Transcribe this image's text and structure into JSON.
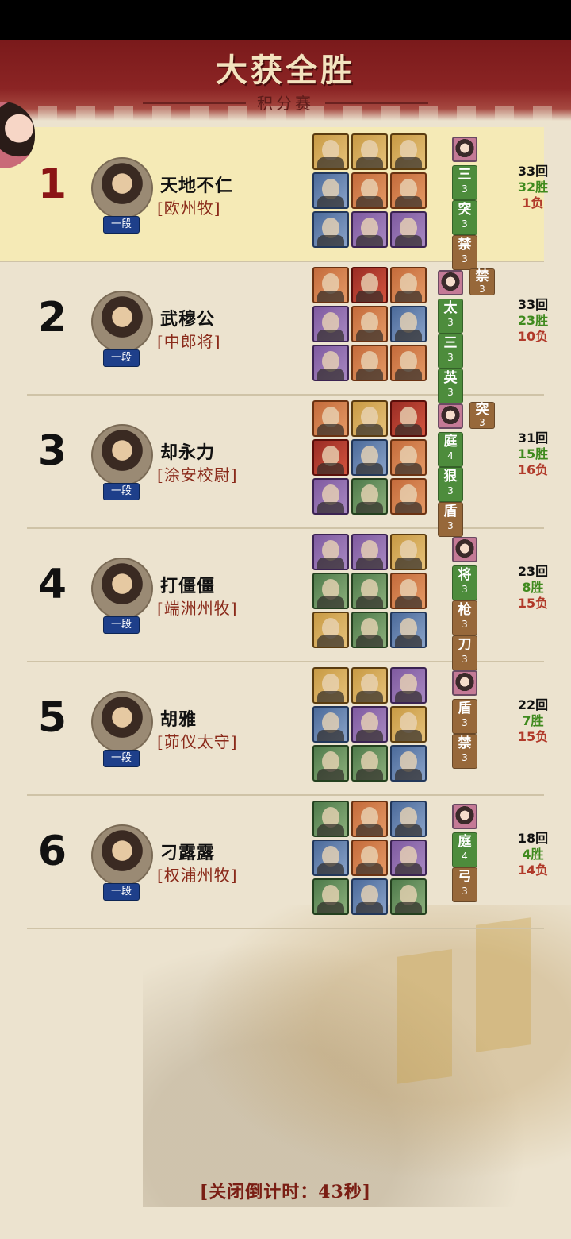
{
  "header": {
    "title": "大获全胜",
    "subtitle": "积分赛"
  },
  "players": [
    {
      "rank": "1",
      "name": "天地不仁",
      "title": "[欧州牧]",
      "badge": "一段",
      "rounds": "33回",
      "wins": "32胜",
      "losses": "1负",
      "highlight": true,
      "cards": [
        "gold",
        "gold",
        "gold",
        "blue",
        "orange",
        "orange",
        "blue",
        "purple",
        "purple"
      ],
      "tags": [
        {
          "char": "三",
          "level": "3",
          "color": "green"
        },
        {
          "char": "突",
          "level": "3",
          "color": "green"
        },
        {
          "char": "禁",
          "level": "3",
          "color": "brown"
        }
      ]
    },
    {
      "rank": "2",
      "name": "武穆公",
      "title": "[中郎将]",
      "badge": "一段",
      "rounds": "33回",
      "wins": "23胜",
      "losses": "10负",
      "cards": [
        "orange",
        "red",
        "orange",
        "purple",
        "orange",
        "blue",
        "purple",
        "orange",
        "orange"
      ],
      "side_tag": {
        "char": "禁",
        "level": "3",
        "color": "brown"
      },
      "tags": [
        {
          "char": "太",
          "level": "3",
          "color": "green"
        },
        {
          "char": "三",
          "level": "3",
          "color": "green"
        },
        {
          "char": "英",
          "level": "3",
          "color": "green"
        }
      ]
    },
    {
      "rank": "3",
      "name": "却永力",
      "title": "[涂安校尉]",
      "badge": "一段",
      "rounds": "31回",
      "wins": "15胜",
      "losses": "16负",
      "cards": [
        "orange",
        "gold",
        "red",
        "red",
        "blue",
        "orange",
        "purple",
        "green",
        "orange"
      ],
      "side_tag": {
        "char": "突",
        "level": "3",
        "color": "brown"
      },
      "tags": [
        {
          "char": "庭",
          "level": "4",
          "color": "green"
        },
        {
          "char": "狠",
          "level": "3",
          "color": "green"
        },
        {
          "char": "盾",
          "level": "3",
          "color": "brown"
        }
      ]
    },
    {
      "rank": "4",
      "name": "打僵僵",
      "title": "[端洲州牧]",
      "badge": "一段",
      "rounds": "23回",
      "wins": "8胜",
      "losses": "15负",
      "cards": [
        "purple",
        "purple",
        "gold",
        "green",
        "green",
        "orange",
        "gold",
        "green",
        "blue"
      ],
      "tags": [
        {
          "char": "将",
          "level": "3",
          "color": "green"
        },
        {
          "char": "枪",
          "level": "3",
          "color": "brown"
        },
        {
          "char": "刀",
          "level": "3",
          "color": "brown"
        }
      ]
    },
    {
      "rank": "5",
      "name": "胡雅",
      "title": "[茆仪太守]",
      "badge": "一段",
      "rounds": "22回",
      "wins": "7胜",
      "losses": "15负",
      "cards": [
        "gold",
        "gold",
        "purple",
        "blue",
        "purple",
        "gold",
        "green",
        "green",
        "blue"
      ],
      "tags": [
        {
          "char": "盾",
          "level": "3",
          "color": "brown"
        },
        {
          "char": "禁",
          "level": "3",
          "color": "brown"
        }
      ]
    },
    {
      "rank": "6",
      "name": "刁露露",
      "title": "[权浦州牧]",
      "badge": "一段",
      "rounds": "18回",
      "wins": "4胜",
      "losses": "14负",
      "cards": [
        "green",
        "orange",
        "blue",
        "blue",
        "orange",
        "purple",
        "green",
        "blue",
        "green"
      ],
      "tags": [
        {
          "char": "庭",
          "level": "4",
          "color": "green"
        },
        {
          "char": "弓",
          "level": "3",
          "color": "brown"
        }
      ]
    }
  ],
  "footer": {
    "countdown": "[关闭倒计时：43秒]"
  }
}
